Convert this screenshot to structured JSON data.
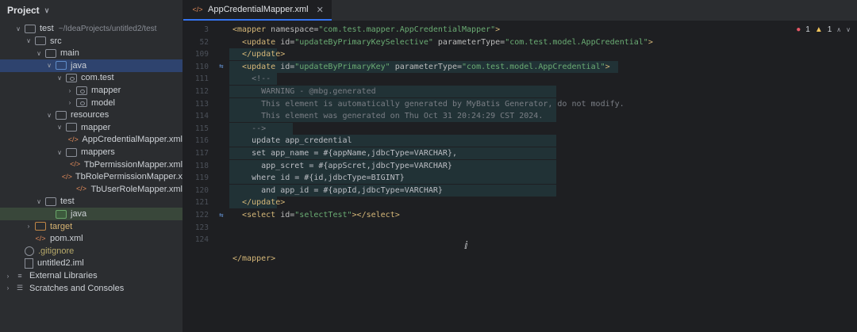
{
  "project": {
    "title": "Project",
    "tree": [
      {
        "label": "test",
        "extra": "~/IdeaProjects/untitled2/test",
        "icon": "folder",
        "arrow": "down",
        "indent": 0
      },
      {
        "label": "src",
        "icon": "folder",
        "arrow": "down",
        "indent": 1
      },
      {
        "label": "main",
        "icon": "folder",
        "arrow": "down",
        "indent": 2
      },
      {
        "label": "java",
        "icon": "folder-blue",
        "arrow": "down",
        "indent": 3,
        "selected": true
      },
      {
        "label": "com.test",
        "icon": "package",
        "arrow": "down",
        "indent": 4
      },
      {
        "label": "mapper",
        "icon": "package",
        "arrow": "right",
        "indent": 5
      },
      {
        "label": "model",
        "icon": "package",
        "arrow": "right",
        "indent": 5
      },
      {
        "label": "resources",
        "icon": "folder-res",
        "arrow": "down",
        "indent": 3
      },
      {
        "label": "mapper",
        "icon": "folder",
        "arrow": "down",
        "indent": 4
      },
      {
        "label": "AppCredentialMapper.xml",
        "icon": "xml",
        "arrow": "",
        "indent": 5
      },
      {
        "label": "mappers",
        "icon": "folder",
        "arrow": "down",
        "indent": 4
      },
      {
        "label": "TbPermissionMapper.xml",
        "icon": "xml",
        "arrow": "",
        "indent": 5
      },
      {
        "label": "TbRolePermissionMapper.x",
        "icon": "xml",
        "arrow": "",
        "indent": 5
      },
      {
        "label": "TbUserRoleMapper.xml",
        "icon": "xml",
        "arrow": "",
        "indent": 5
      },
      {
        "label": "test",
        "icon": "folder",
        "arrow": "down",
        "indent": 2
      },
      {
        "label": "java",
        "icon": "folder-green",
        "arrow": "",
        "indent": 3,
        "highlight": true
      },
      {
        "label": "target",
        "icon": "folder-orange",
        "arrow": "right",
        "indent": 1,
        "orange": true
      },
      {
        "label": "pom.xml",
        "icon": "xml",
        "arrow": "",
        "indent": 1
      },
      {
        "label": ".gitignore",
        "icon": "ignore",
        "arrow": "",
        "indent": 0,
        "ignored": true
      },
      {
        "label": "untitled2.iml",
        "icon": "file",
        "arrow": "",
        "indent": 0
      },
      {
        "label": "External Libraries",
        "icon": "library",
        "arrow": "right",
        "indent": -1
      },
      {
        "label": "Scratches and Consoles",
        "icon": "scratch",
        "arrow": "right",
        "indent": -1
      }
    ]
  },
  "editor": {
    "tab_label": "AppCredentialMapper.xml",
    "errors": "1",
    "warnings": "1",
    "lines": [
      {
        "num": "3",
        "parts": [
          [
            "tag",
            "<mapper "
          ],
          [
            "attr",
            "namespace="
          ],
          [
            "str",
            "\"com.test.mapper.AppCredentialMapper\""
          ],
          [
            "tag",
            ">"
          ]
        ]
      },
      {
        "num": "52",
        "parts": [
          [
            "plain",
            "  "
          ],
          [
            "tag",
            "<update "
          ],
          [
            "attr",
            "id="
          ],
          [
            "str",
            "\"updateByPrimaryKeySelective\" "
          ],
          [
            "attr",
            "parameterType="
          ],
          [
            "str",
            "\"com.test.model.AppCredential\""
          ],
          [
            "tag",
            ">"
          ]
        ]
      },
      {
        "num": "109",
        "parts": [
          [
            "plain",
            "  "
          ],
          [
            "tag",
            "</update>"
          ]
        ]
      },
      {
        "num": "110",
        "parts": [
          [
            "plain",
            "  "
          ],
          [
            "tag",
            "<update "
          ],
          [
            "attr",
            "id="
          ],
          [
            "str",
            "\"updateByPrimaryKey\" "
          ],
          [
            "attr",
            "parameterType="
          ],
          [
            "str",
            "\"com.test.model.AppCredential\""
          ],
          [
            "tag",
            ">"
          ]
        ]
      },
      {
        "num": "111",
        "parts": [
          [
            "comment",
            "    <!--"
          ]
        ]
      },
      {
        "num": "112",
        "parts": [
          [
            "comment",
            "      WARNING - @mbg.generated"
          ]
        ]
      },
      {
        "num": "113",
        "parts": [
          [
            "comment",
            "      This element is automatically generated by MyBatis Generator, do not modify."
          ]
        ]
      },
      {
        "num": "114",
        "parts": [
          [
            "comment",
            "      This element was generated on Thu Oct 31 20:24:29 CST 2024."
          ]
        ]
      },
      {
        "num": "115",
        "parts": [
          [
            "comment",
            "    -->"
          ]
        ]
      },
      {
        "num": "116",
        "parts": [
          [
            "plain",
            "    update app_credential"
          ]
        ]
      },
      {
        "num": "117",
        "parts": [
          [
            "plain",
            "    set app_name = #{appName,jdbcType=VARCHAR},"
          ]
        ]
      },
      {
        "num": "118",
        "parts": [
          [
            "plain",
            "      app_scret = #{appScret,jdbcType=VARCHAR}"
          ]
        ]
      },
      {
        "num": "119",
        "parts": [
          [
            "plain",
            "    where id = #{id,jdbcType=BIGINT}"
          ]
        ]
      },
      {
        "num": "120",
        "parts": [
          [
            "plain",
            "      and app_id = #{appId,jdbcType=VARCHAR}"
          ]
        ]
      },
      {
        "num": "121",
        "parts": [
          [
            "plain",
            "  "
          ],
          [
            "tag",
            "</update>"
          ]
        ]
      },
      {
        "num": "122",
        "parts": [
          [
            "plain",
            "  "
          ],
          [
            "tag",
            "<select "
          ],
          [
            "attr",
            "id="
          ],
          [
            "str",
            "\"selectTest\""
          ],
          [
            "tag",
            "></select>"
          ]
        ]
      },
      {
        "num": "123",
        "parts": []
      },
      {
        "num": "124",
        "parts": []
      },
      {
        "num": "",
        "parts": [
          [
            "tag",
            "</mapper>"
          ]
        ]
      }
    ]
  }
}
